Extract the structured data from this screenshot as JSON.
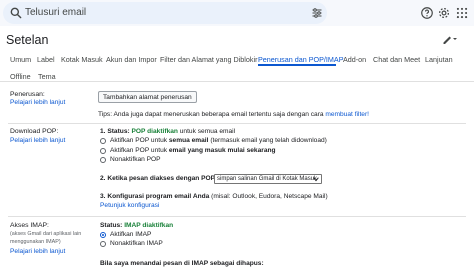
{
  "search": {
    "placeholder": "Telusuri email"
  },
  "header": {
    "title": "Setelan"
  },
  "tabs": [
    {
      "label": "Umum"
    },
    {
      "label": "Label"
    },
    {
      "label": "Kotak Masuk"
    },
    {
      "label": "Akun dan Impor"
    },
    {
      "label": "Filter dan Alamat yang Diblokir"
    },
    {
      "label": "Penerusan dan POP/IMAP"
    },
    {
      "label": "Add-on"
    },
    {
      "label": "Chat dan Meet"
    },
    {
      "label": "Lanjutan"
    },
    {
      "label": "Offline"
    },
    {
      "label": "Tema"
    }
  ],
  "forwarding": {
    "label": "Penerusan:",
    "learn_more": "Pelajari lebih lanjut",
    "add_button": "Tambahkan alamat penerusan",
    "tip_prefix": "Tips: Anda juga dapat meneruskan beberapa email tertentu saja dengan cara ",
    "tip_link": "membuat filter!"
  },
  "pop": {
    "label": "Download POP:",
    "learn_more": "Pelajari lebih lanjut",
    "status_prefix": "1. Status: ",
    "status_value": "POP diaktifkan",
    "status_suffix": " untuk semua email",
    "option1_prefix": "Aktifkan POP untuk ",
    "option1_bold": "semua email",
    "option1_suffix": " (termasuk email yang telah didownload)",
    "option2_prefix": "Aktifkan POP untuk ",
    "option2_bold": "email yang masuk mulai sekarang",
    "option3": "Nonaktifkan POP",
    "step2": "2. Ketika pesan diakses dengan POP",
    "step2_select": "simpan salinan Gmail di Kotak Masuk",
    "step3": "3. Konfigurasi program email Anda",
    "step3_suffix": " (misal: Outlook, Eudora, Netscape Mail)",
    "config_link": "Petunjuk konfigurasi"
  },
  "imap": {
    "label": "Akses IMAP:",
    "sub1": "(akses Gmail dari aplikasi lain",
    "sub2": "menggunakan IMAP)",
    "learn_more": "Pelajari lebih lanjut",
    "status_prefix": "Status: ",
    "status_value": "IMAP diaktifkan",
    "option1": "Aktifkan IMAP",
    "option2": "Nonaktifkan IMAP",
    "delete_heading": "Bila saya menandai pesan di IMAP sebagai dihapus:"
  },
  "colors": {
    "accent": "#0b57d0",
    "status_green": "#188038"
  }
}
